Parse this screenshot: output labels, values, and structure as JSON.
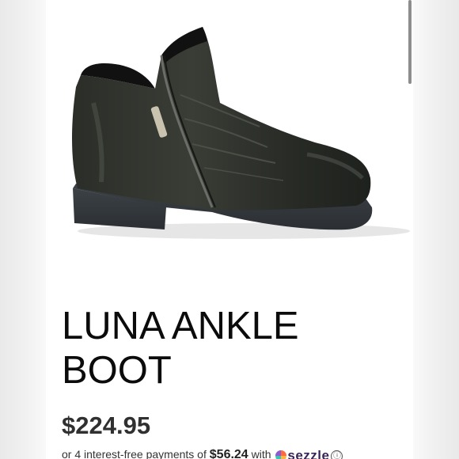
{
  "product": {
    "title": "LUNA ANKLE BOOT",
    "price": "$224.95",
    "image_icon": "ankle-boot-photo"
  },
  "installments": {
    "prefix": "or 4 interest-free payments of ",
    "amount": "$56.24",
    "suffix": " with ",
    "provider": "sezzle",
    "info_icon": "ⓘ"
  },
  "colors": {
    "title": "#0b0b0b",
    "price": "#303030",
    "sezzle_brand": "#392558",
    "boot_leather": "#2a2d28"
  }
}
